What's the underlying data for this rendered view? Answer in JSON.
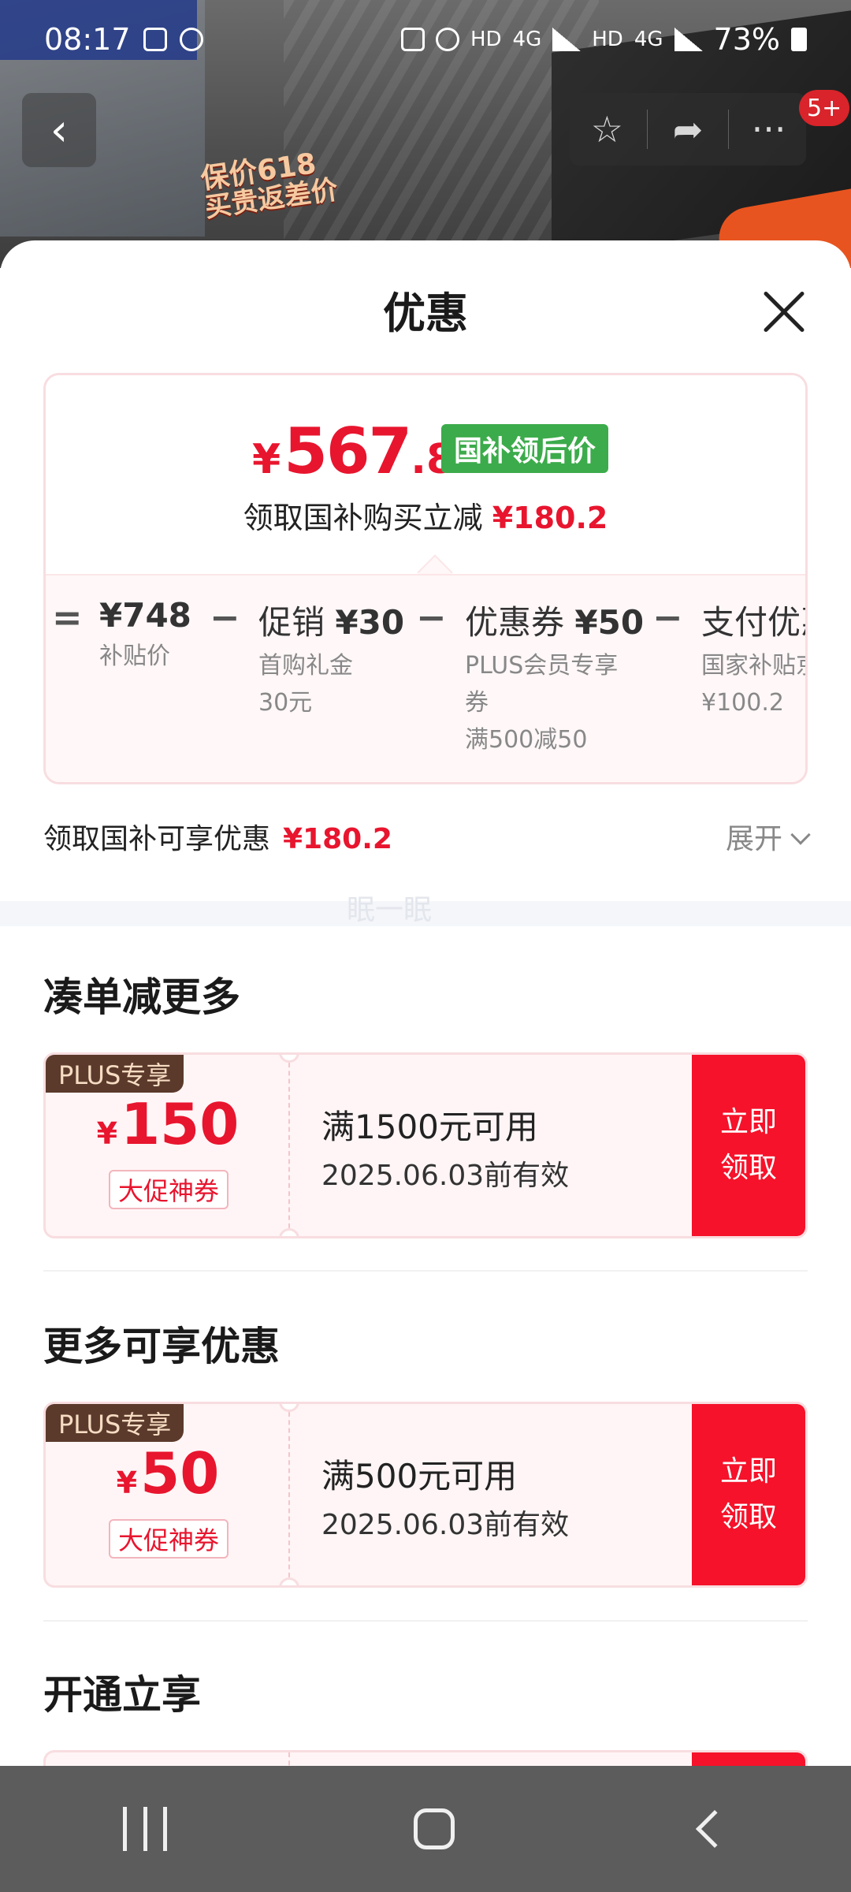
{
  "status_bar": {
    "time": "08:17",
    "network_labels": [
      "HD",
      "4G",
      "HD",
      "4G"
    ],
    "battery": "73%"
  },
  "background": {
    "promo_line1": "保价618",
    "promo_line2": "买贵返差价",
    "cart_badge": "5+"
  },
  "sheet": {
    "title": "优惠",
    "price": {
      "currency": "¥",
      "integer": "567",
      "decimal": ".8",
      "tag": "国补领后价",
      "subtitle": "领取国补购买立减",
      "subtitle_amount": "¥180.2"
    },
    "breakdown": {
      "items": [
        {
          "op": "=",
          "label": "",
          "amount": "¥748",
          "desc": [
            "补贴价"
          ]
        },
        {
          "op": "−",
          "label": "促销",
          "amount": "¥30",
          "desc": [
            "首购礼金",
            "30元"
          ]
        },
        {
          "op": "−",
          "label": "优惠券",
          "amount": "¥50",
          "desc": [
            "PLUS会员专享",
            "券",
            "满500减50"
          ]
        },
        {
          "op": "−",
          "label": "支付优惠",
          "amount": "",
          "desc": [
            "国家补贴京",
            "¥100.2"
          ]
        }
      ]
    },
    "promo_row": {
      "label": "领取国补可享优惠",
      "amount": "¥180.2",
      "expand": "展开"
    },
    "watermark": "眠一眠",
    "sections": [
      {
        "title": "凑单减更多",
        "coupon": {
          "tag": "PLUS专享",
          "currency": "¥",
          "amount": "150",
          "label": "大促神券",
          "condition": "满1500元可用",
          "validity": "2025.06.03前有效",
          "claim_line1": "立即",
          "claim_line2": "领取"
        }
      },
      {
        "title": "更多可享优惠",
        "coupon": {
          "tag": "PLUS专享",
          "currency": "¥",
          "amount": "50",
          "label": "大促神券",
          "condition": "满500元可用",
          "validity": "2025.06.03前有效",
          "claim_line1": "立即",
          "claim_line2": "领取"
        }
      },
      {
        "title": "开通立享"
      }
    ]
  },
  "colors": {
    "accent_red": "#e8152e",
    "claim_red": "#f5122a",
    "tag_green": "#3cab4b",
    "plus_brown": "#5b3a2c"
  }
}
